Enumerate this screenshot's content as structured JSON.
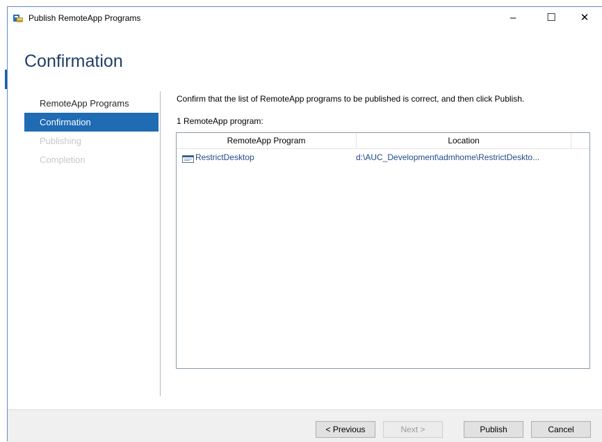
{
  "window": {
    "title": "Publish RemoteApp Programs",
    "controls": {
      "minimize": "–",
      "maximize": "☐",
      "close": "✕"
    }
  },
  "page": {
    "heading": "Confirmation",
    "instruction": "Confirm that the list of RemoteApp programs to be published is correct, and then click Publish.",
    "count_label": "1 RemoteApp program:"
  },
  "nav": {
    "items": [
      {
        "label": "RemoteApp Programs",
        "state": "normal"
      },
      {
        "label": "Confirmation",
        "state": "active"
      },
      {
        "label": "Publishing",
        "state": "disabled"
      },
      {
        "label": "Completion",
        "state": "disabled"
      }
    ]
  },
  "list": {
    "columns": [
      "RemoteApp Program",
      "Location"
    ],
    "rows": [
      {
        "program": "RestrictDesktop",
        "location": "d:\\AUC_Development\\admhome\\RestrictDeskto..."
      }
    ]
  },
  "buttons": {
    "previous": "< Previous",
    "next": "Next >",
    "publish": "Publish",
    "cancel": "Cancel"
  },
  "colors": {
    "accent": "#1f6bb4",
    "heading": "#1f3f66",
    "link_text": "#1f4a8a"
  },
  "icons": {
    "app": "remoteapp-icon",
    "row": "application-icon"
  }
}
